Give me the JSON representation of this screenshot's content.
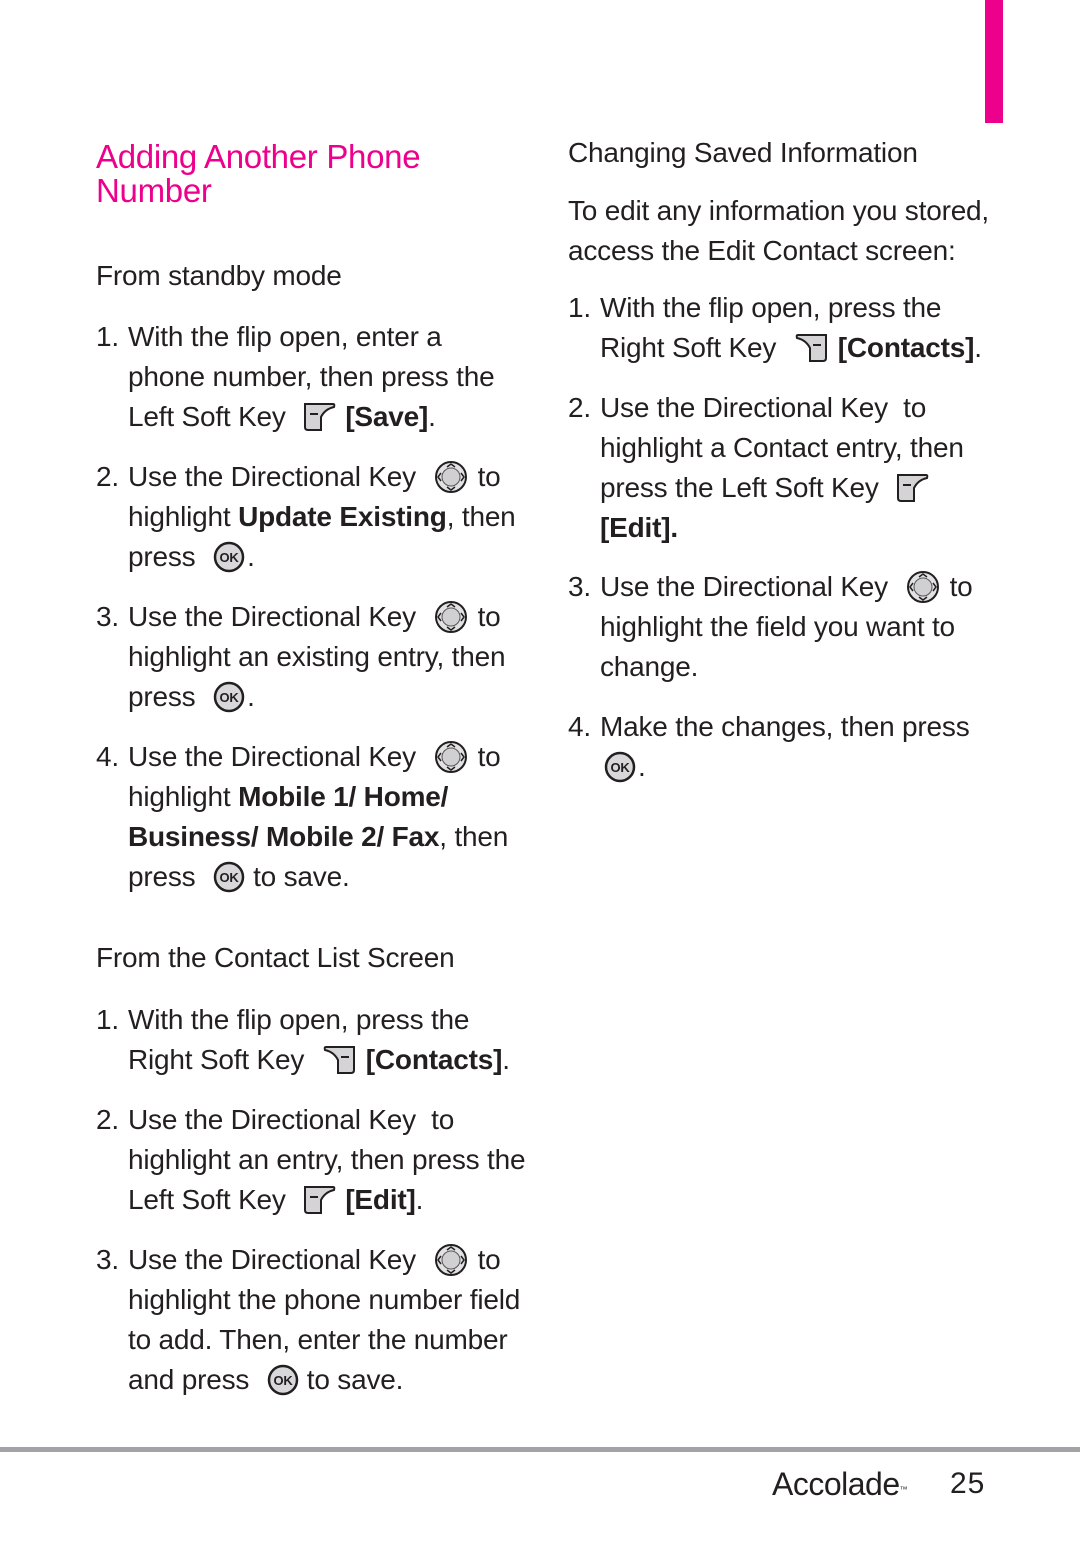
{
  "page": {
    "accent_color": "#ec008c",
    "footer": {
      "brand": "Accolade",
      "trademark": "™",
      "page_number": "25"
    }
  },
  "left": {
    "title_lines": [
      "Adding Another Phone",
      "Number"
    ],
    "standby": {
      "heading": "From standby mode",
      "steps": [
        {
          "num": "1.",
          "l1": "With the flip open, enter a",
          "l2": "phone number, then press the",
          "l3a": "Left Soft Key",
          "l3b": "[Save]",
          "l3c": "."
        },
        {
          "num": "2.",
          "l1a": "Use the Directional Key",
          "l1b": "to",
          "l2a": "highlight",
          "l2b": "Update Existing",
          "l2c": ", then",
          "l3a": "press",
          "l3b": "."
        },
        {
          "num": "3.",
          "l1a": "Use the Directional Key",
          "l1b": "to",
          "l2": "highlight an existing entry, then",
          "l3a": "press",
          "l3b": "."
        },
        {
          "num": "4.",
          "l1a": "Use the Directional Key",
          "l1b": "to",
          "l2a": "highlight",
          "l2b": "Mobile 1/ Home/",
          "l3a": "Business/ Mobile 2/ Fax",
          "l3b": ", then",
          "l4a": "press",
          "l4b": "to save."
        }
      ]
    },
    "contact_list": {
      "heading": "From the Contact List Screen",
      "steps": [
        {
          "num": "1.",
          "l1": "With the flip open, press the",
          "l2a": "Right Soft Key",
          "l2b": "[Contacts]",
          "l2c": "."
        },
        {
          "num": "2.",
          "l1": "Use the Directional Key  to",
          "l2": "highlight an entry, then press the",
          "l3a": "Left Soft Key",
          "l3b": "[Edit]",
          "l3c": "."
        },
        {
          "num": "3.",
          "l1a": "Use the Directional Key",
          "l1b": "to",
          "l2": "highlight the phone number field",
          "l3": "to add. Then, enter the number",
          "l4a": "and press",
          "l4b": "to save."
        }
      ]
    }
  },
  "right": {
    "heading": "Changing Saved Information",
    "intro_lines": [
      "To edit any information you stored,",
      "access the Edit Contact screen:"
    ],
    "steps": [
      {
        "num": "1.",
        "l1": "With the flip open, press the",
        "l2a": "Right Soft Key",
        "l2b": "[Contacts]",
        "l2c": "."
      },
      {
        "num": "2.",
        "l1": "Use the Directional Key  to",
        "l2": "highlight a Contact entry, then",
        "l3a": "press the Left Soft Key",
        "l4": "[Edit]."
      },
      {
        "num": "3.",
        "l1a": "Use the Directional Key",
        "l1b": "to",
        "l2": "highlight the field you want to",
        "l3": "change."
      },
      {
        "num": "4.",
        "l1": "Make the changes, then press",
        "l2": "."
      }
    ]
  },
  "icons": {
    "left_soft_key": "left-soft-key-icon",
    "right_soft_key": "right-soft-key-icon",
    "directional_key": "directional-key-icon",
    "ok_key": "ok-key-icon"
  }
}
